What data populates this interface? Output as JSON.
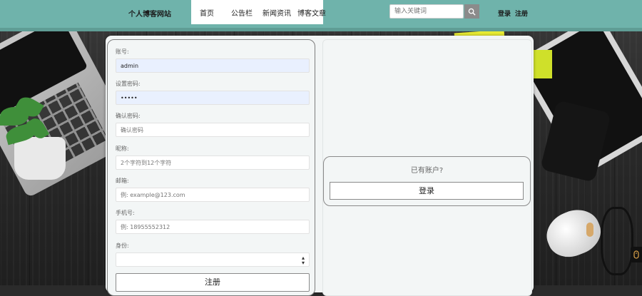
{
  "header": {
    "site_title": "个人博客网站",
    "nav": [
      {
        "label": "首页"
      },
      {
        "label": "公告栏"
      },
      {
        "label": "新闻资讯"
      },
      {
        "label": "博客文章"
      }
    ],
    "search": {
      "placeholder": "输入关键词",
      "icon": "search-icon"
    },
    "login_label": "登录",
    "register_label": "注册"
  },
  "form": {
    "account": {
      "label": "账号:",
      "value": "admin"
    },
    "password": {
      "label": "设置密码:",
      "value": "•••••"
    },
    "confirm_password": {
      "label": "确认密码:",
      "placeholder": "确认密码"
    },
    "nickname": {
      "label": "昵称:",
      "placeholder": "2个字符到12个字符"
    },
    "email": {
      "label": "邮箱:",
      "placeholder": "例: example@123.com"
    },
    "phone": {
      "label": "手机号:",
      "placeholder": "例: 18955552312"
    },
    "identity": {
      "label": "身份:",
      "value": ""
    },
    "submit_label": "注册"
  },
  "login_panel": {
    "prompt": "已有账户?",
    "button_label": "登录"
  },
  "colors": {
    "navbar": "#6fb3ab",
    "card": "#f2f5f5",
    "autofill": "#e9f0fe"
  }
}
